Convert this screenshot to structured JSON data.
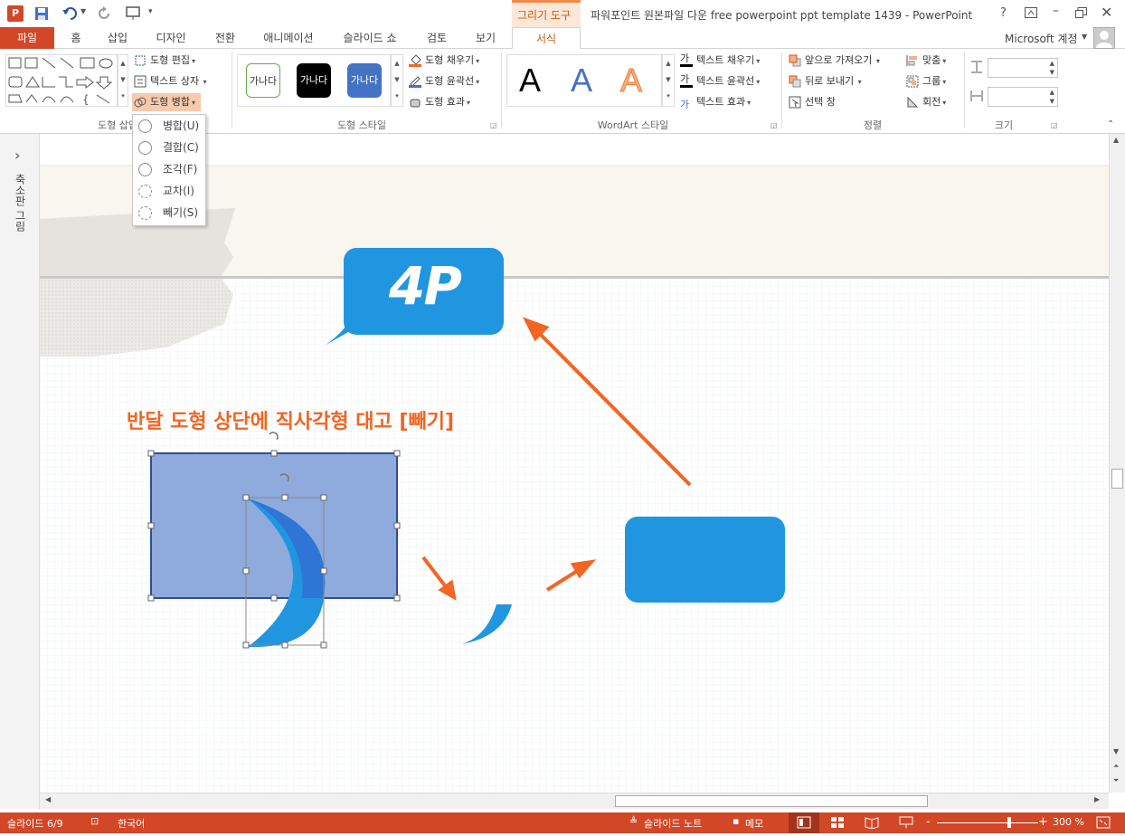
{
  "app": {
    "title": "파워포인트 원본파일 다운 free powerpoint ppt template 1439 - PowerPoint",
    "contextual_tab": "그리기 도구",
    "help": "?",
    "account": "Microsoft 계정"
  },
  "tabs": [
    "파일",
    "홈",
    "삽입",
    "디자인",
    "전환",
    "애니메이션",
    "슬라이드 쇼",
    "검토",
    "보기",
    "서식"
  ],
  "ribbon": {
    "shape_edit": "도형 편집",
    "text_box": "텍스트 상자",
    "merge_shapes": "도형 병합",
    "group_insert_shapes": "도형 삽입",
    "style_samples": [
      "가나다",
      "가나다",
      "가나다"
    ],
    "shape_fill": "도형 채우기",
    "shape_outline": "도형 윤곽선",
    "shape_effects": "도형 효과",
    "group_shape_styles": "도형 스타일",
    "wordart_samples": [
      "A",
      "A",
      "A"
    ],
    "text_fill": "텍스트 채우기",
    "text_outline": "텍스트 윤곽선",
    "text_effects": "텍스트 효과",
    "group_wordart": "WordArt 스타일",
    "bring_forward": "앞으로 가져오기",
    "send_backward": "뒤로 보내기",
    "selection_pane": "선택 창",
    "align": "맞춤",
    "group": "그룹",
    "rotate": "회전",
    "group_arrange": "정렬",
    "group_size": "크기"
  },
  "merge_menu": [
    {
      "label": "병합(U)"
    },
    {
      "label": "결합(C)"
    },
    {
      "label": "조각(F)"
    },
    {
      "label": "교차(I)"
    },
    {
      "label": "빼기(S)"
    }
  ],
  "left_pane": {
    "label": "축소판 그림",
    "toggle": "›"
  },
  "slide": {
    "speech_text": "4P",
    "instruction": "반달 도형 상단에 직사각형 대고 [빼기]",
    "colors": {
      "blue": "#2196e0",
      "orange": "#f26522",
      "sel_rect": "#8faadc",
      "moon": "#2e75d6"
    }
  },
  "status": {
    "slide": "슬라이드 6/9",
    "language": "한국어",
    "notes": "슬라이드 노트",
    "comments": "메모",
    "zoom": "300 %",
    "minus": "-",
    "plus": "+"
  }
}
